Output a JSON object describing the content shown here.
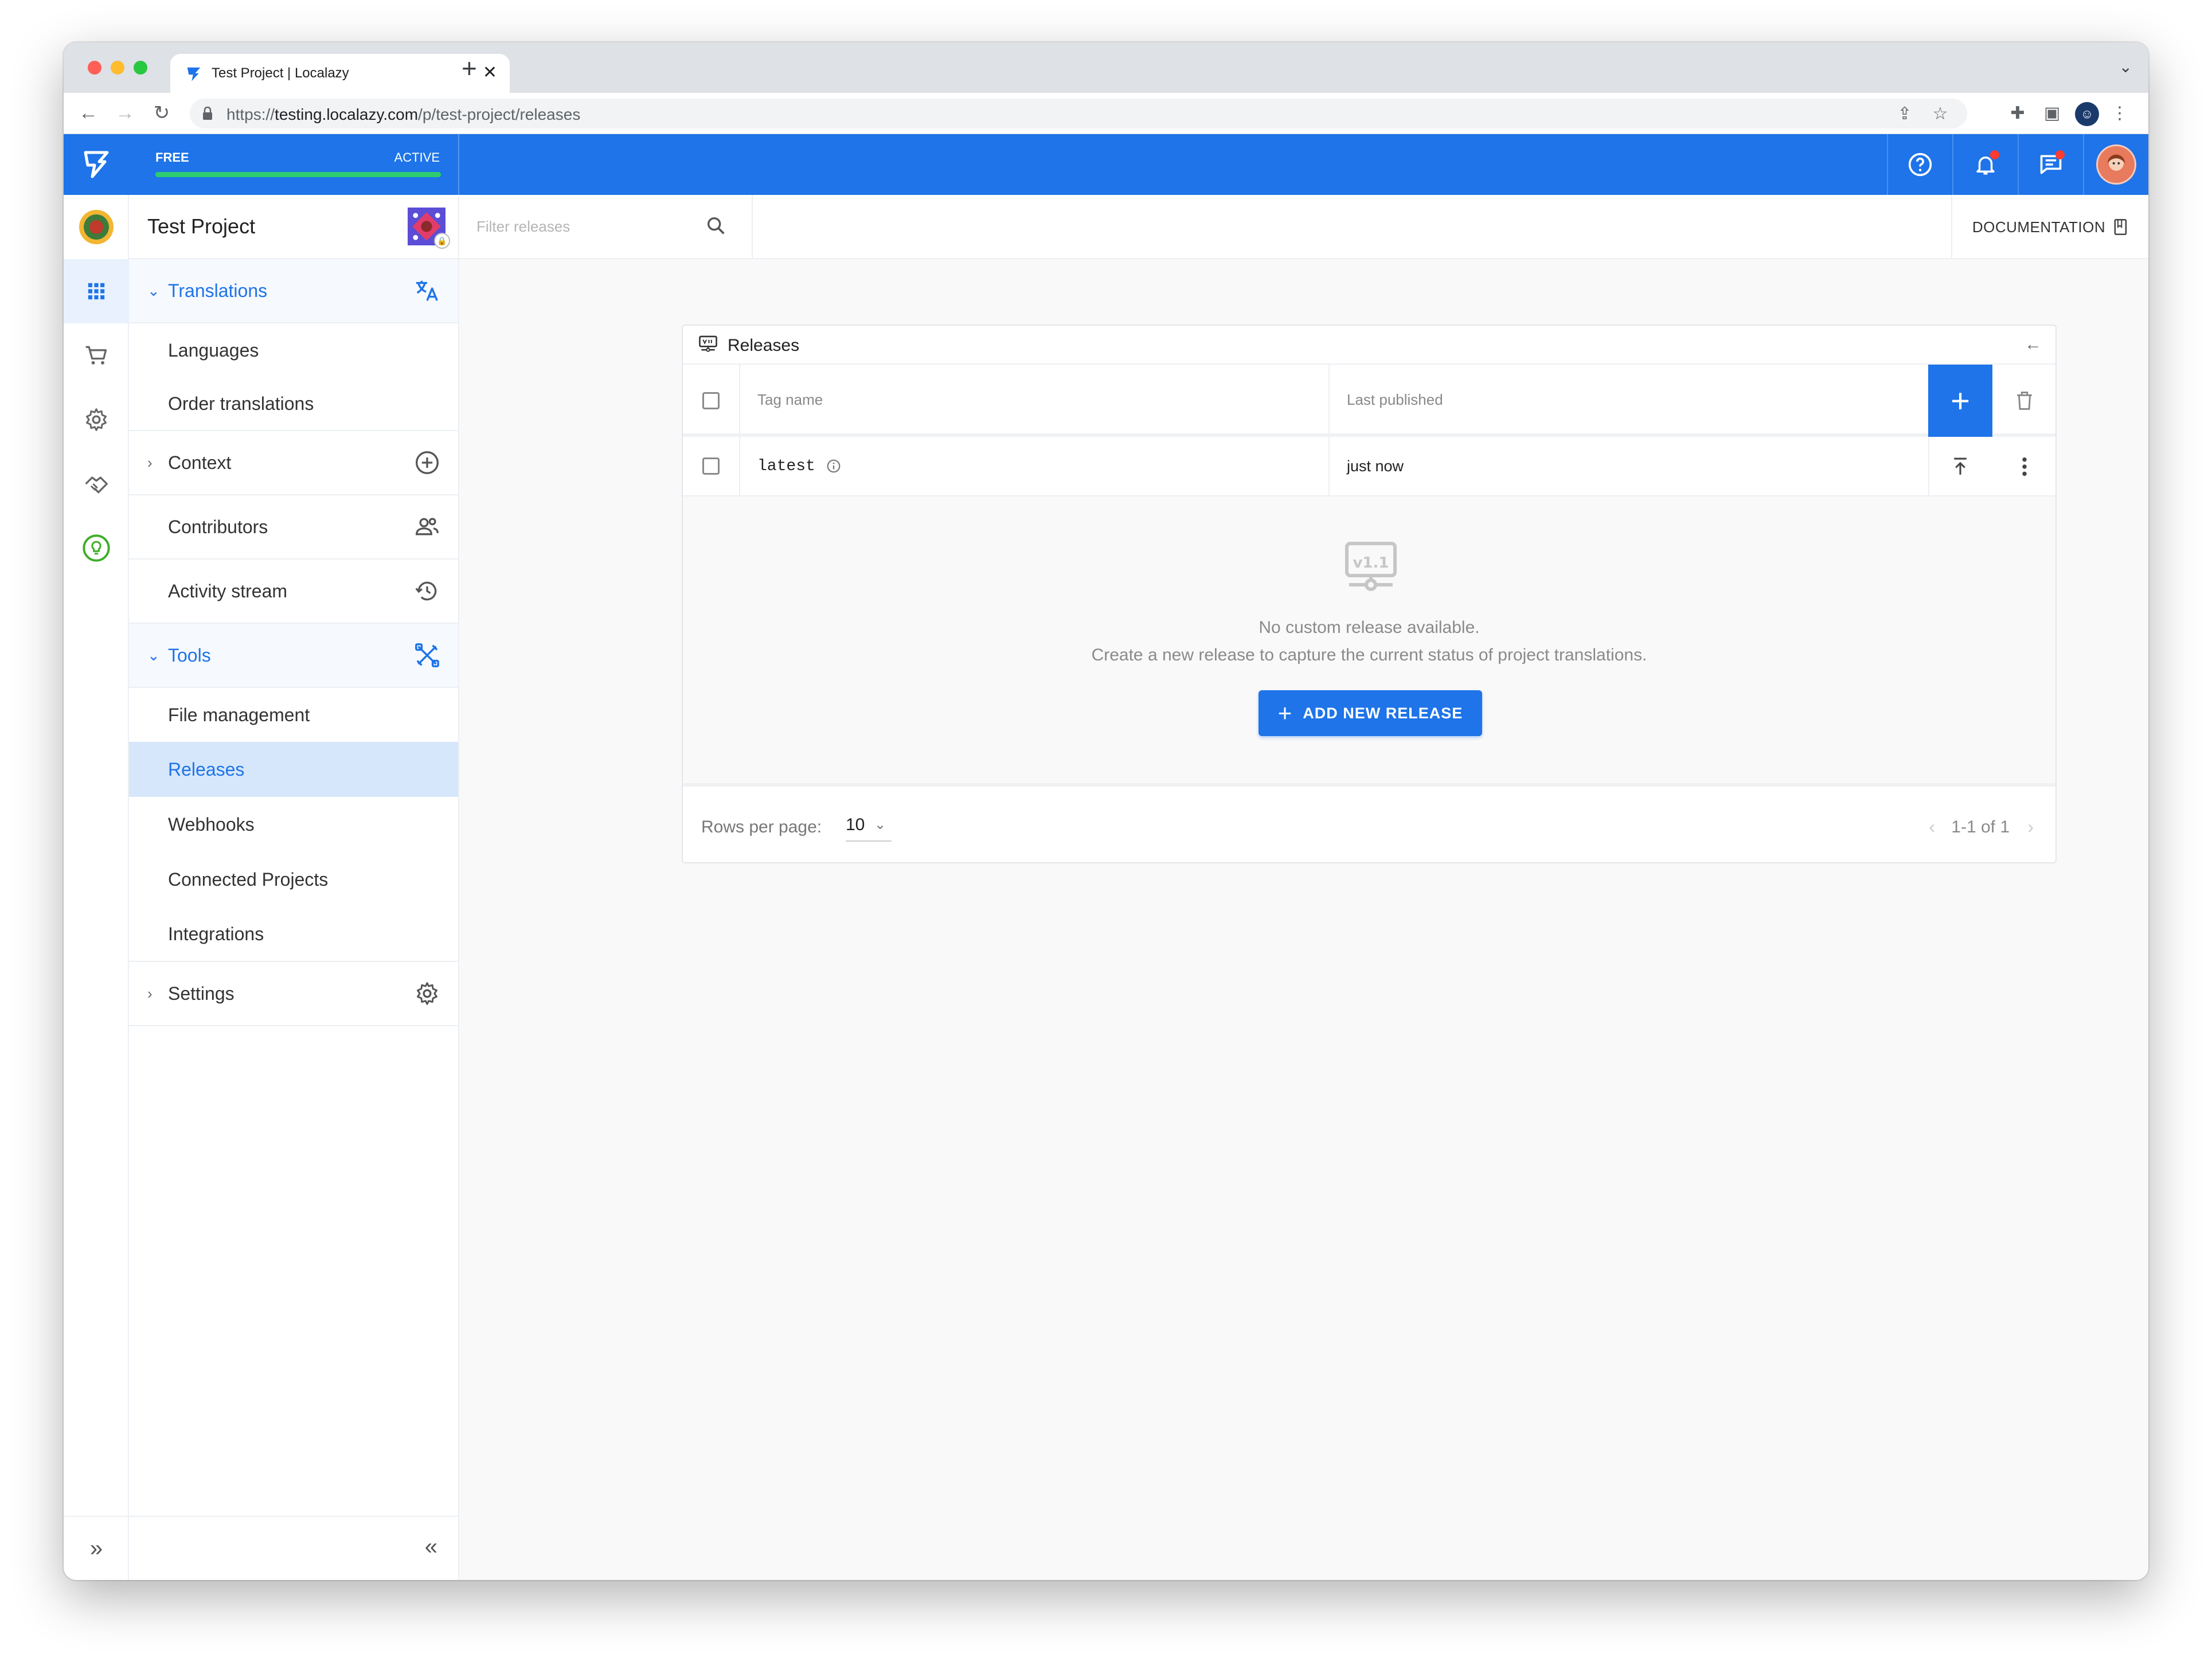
{
  "browser": {
    "tab_title": "Test Project | Localazy",
    "tab_close": "✕",
    "new_tab": "+",
    "url_prefix": "https://",
    "url_host": "testing.localazy.com",
    "url_path": "/p/test-project/releases"
  },
  "header": {
    "plan_name": "FREE",
    "plan_status": "ACTIVE",
    "plan_progress": 1.0,
    "accent": "#1e74e8"
  },
  "sidebar": {
    "project_name": "Test Project",
    "sections": {
      "translations": "Translations",
      "tools": "Tools"
    },
    "items": {
      "languages": "Languages",
      "order_translations": "Order translations",
      "context": "Context",
      "contributors": "Contributors",
      "activity_stream": "Activity stream",
      "file_management": "File management",
      "releases": "Releases",
      "webhooks": "Webhooks",
      "connected_projects": "Connected Projects",
      "integrations": "Integrations",
      "settings": "Settings"
    }
  },
  "main": {
    "filter_placeholder": "Filter releases",
    "documentation": "DOCUMENTATION",
    "card_title": "Releases",
    "columns": [
      "Tag name",
      "Last published"
    ],
    "rows": [
      {
        "tag": "latest",
        "published": "just now"
      }
    ],
    "empty_title": "No custom release available.",
    "empty_subtitle": "Create a new release to capture the current status of project translations.",
    "empty_icon_label": "v1.1",
    "cta_label": "ADD NEW RELEASE",
    "rows_per_page_label": "Rows per page:",
    "rows_per_page_value": "10",
    "page_range": "1-1 of 1"
  }
}
